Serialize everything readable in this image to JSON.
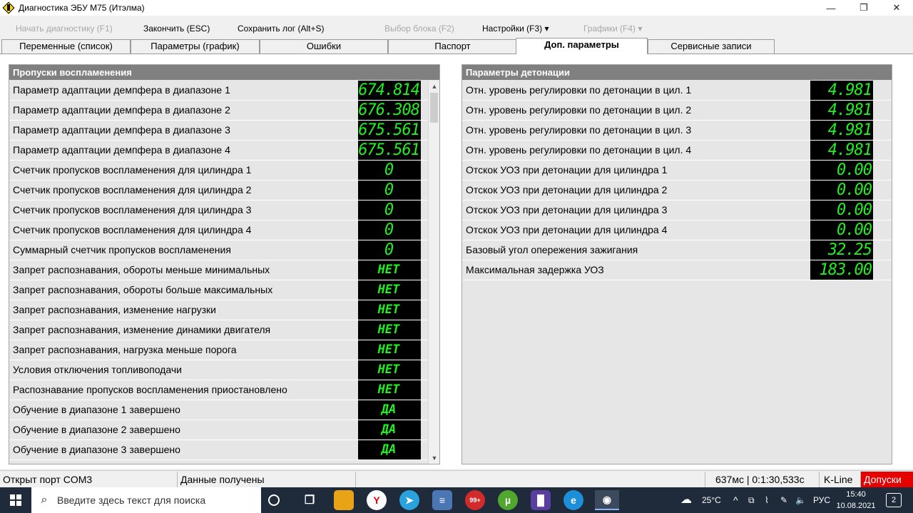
{
  "window": {
    "title": "Диагностика ЭБУ М75 (Итэлма)",
    "controls": {
      "minimize": "—",
      "maximize": "❐",
      "close": "✕"
    }
  },
  "menu": {
    "start_diag": "Начать диагностику (F1)",
    "finish": "Закончить (ESC)",
    "save_log": "Сохранить лог (Alt+S)",
    "select_block": "Выбор блока (F2)",
    "settings": "Настройки (F3) ▾",
    "charts": "Графики (F4) ▾"
  },
  "tabs": [
    {
      "label": "Переменные (список)"
    },
    {
      "label": "Параметры (график)"
    },
    {
      "label": "Ошибки"
    },
    {
      "label": "Паспорт"
    },
    {
      "label": "Доп. параметры",
      "active": true
    },
    {
      "label": "Сервисные записи"
    }
  ],
  "left_panel": {
    "title": "Пропуски воспламенения",
    "rows": [
      {
        "label": "Параметр адаптации демпфера в диапазоне 1",
        "value": "674.814"
      },
      {
        "label": "Параметр адаптации демпфера в диапазоне 2",
        "value": "676.308"
      },
      {
        "label": "Параметр адаптации демпфера в диапазоне 3",
        "value": "675.561"
      },
      {
        "label": "Параметр адаптации демпфера в диапазоне 4",
        "value": "675.561"
      },
      {
        "label": "Счетчик пропусков воспламенения для цилиндра 1",
        "value": "0"
      },
      {
        "label": "Счетчик пропусков воспламенения для цилиндра 2",
        "value": "0"
      },
      {
        "label": "Счетчик пропусков воспламенения для цилиндра 3",
        "value": "0"
      },
      {
        "label": "Счетчик пропусков воспламенения для цилиндра 4",
        "value": "0"
      },
      {
        "label": "Суммарный счетчик пропусков воспламенения",
        "value": "0"
      },
      {
        "label": "Запрет распознавания, обороты меньше минимальных",
        "value": "НЕТ"
      },
      {
        "label": "Запрет распознавания, обороты больше максимальных",
        "value": "НЕТ"
      },
      {
        "label": "Запрет распознавания, изменение нагрузки",
        "value": "НЕТ"
      },
      {
        "label": "Запрет распознавания, изменение динамики двигателя",
        "value": "НЕТ"
      },
      {
        "label": "Запрет распознавания, нагрузка меньше порога",
        "value": "НЕТ"
      },
      {
        "label": "Условия отключения топливоподачи",
        "value": "НЕТ"
      },
      {
        "label": "Распознавание пропусков воспламенения приостановлено",
        "value": "НЕТ"
      },
      {
        "label": "Обучение в диапазоне 1 завершено",
        "value": "ДА"
      },
      {
        "label": "Обучение в диапазоне 2 завершено",
        "value": "ДА"
      },
      {
        "label": "Обучение в диапазоне 3 завершено",
        "value": "ДА"
      }
    ]
  },
  "right_panel": {
    "title": "Параметры детонации",
    "rows": [
      {
        "label": "Отн. уровень регулировки по детонации в цил. 1",
        "value": "4.981"
      },
      {
        "label": "Отн. уровень регулировки по детонации в цил. 2",
        "value": "4.981"
      },
      {
        "label": "Отн. уровень регулировки по детонации в цил. 3",
        "value": "4.981"
      },
      {
        "label": "Отн. уровень регулировки по детонации в цил. 4",
        "value": "4.981"
      },
      {
        "label": "Отскок УОЗ при детонации для цилиндра 1",
        "value": "0.00"
      },
      {
        "label": "Отскок УОЗ при детонации для цилиндра 2",
        "value": "0.00"
      },
      {
        "label": "Отскок УОЗ при детонации для цилиндра 3",
        "value": "0.00"
      },
      {
        "label": "Отскок УОЗ при детонации для цилиндра 4",
        "value": "0.00"
      },
      {
        "label": "Базовый угол опережения зажигания",
        "value": "32.25"
      },
      {
        "label": "Максимальная задержка УОЗ",
        "value": "183.00"
      }
    ]
  },
  "status": {
    "port": "Открыт порт COM3",
    "data": "Данные получены",
    "timing": "637мс | 0:1:30,533с",
    "protocol": "K-Line",
    "alert": "Допуски"
  },
  "taskbar": {
    "search_placeholder": "Введите здесь текст для поиска",
    "weather": "25°C",
    "lang": "РУС",
    "time": "15:40",
    "date": "10.08.2021",
    "notifications": "2"
  },
  "colors": {
    "digit_green": "#1ff01f",
    "panel_header": "#808080",
    "alert_red": "#e60000",
    "taskbar": "#1f2a3a"
  }
}
